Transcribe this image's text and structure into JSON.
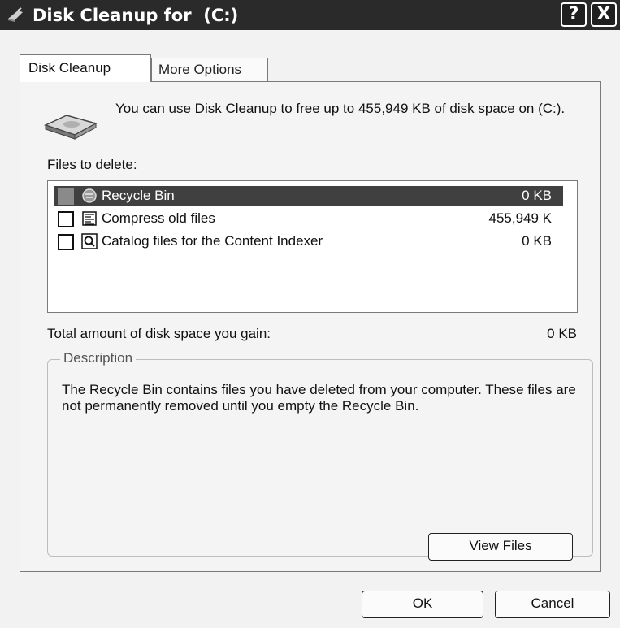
{
  "window": {
    "title": "Disk Cleanup for  (C:)",
    "help_label": "?",
    "close_label": "X"
  },
  "tabs": [
    {
      "label": "Disk Cleanup",
      "active": true
    },
    {
      "label": "More Options",
      "active": false
    }
  ],
  "main": {
    "intro_text": "You can use Disk Cleanup to free up to 455,949 KB of disk space on  (C:).",
    "files_label": "Files to delete:",
    "files": [
      {
        "name": "Recycle Bin",
        "size": "0 KB",
        "checked": false,
        "selected": true,
        "icon": "recycle-bin-icon"
      },
      {
        "name": "Compress old files",
        "size": "455,949 K",
        "checked": false,
        "selected": false,
        "icon": "compress-icon"
      },
      {
        "name": "Catalog files for the Content Indexer",
        "size": "0 KB",
        "checked": false,
        "selected": false,
        "icon": "indexer-icon"
      }
    ],
    "total_label": "Total amount of disk space you gain:",
    "total_value": "0 KB"
  },
  "description": {
    "legend": "Description",
    "text": "The Recycle Bin contains files you have deleted from your computer. These files are not permanently removed until you empty the Recycle Bin.",
    "view_files_label": "View Files"
  },
  "footer": {
    "ok_label": "OK",
    "cancel_label": "Cancel"
  }
}
